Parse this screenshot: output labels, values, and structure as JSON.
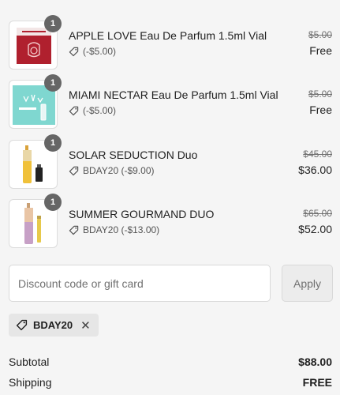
{
  "items": [
    {
      "quantity": "1",
      "name": "APPLE LOVE Eau De Parfum 1.5ml Vial",
      "discount": "(-$5.00)",
      "original_price": "$5.00",
      "final_price": "Free",
      "thumb_icon": "red-perfume-card-icon"
    },
    {
      "quantity": "1",
      "name": "MIAMI NECTAR Eau De Parfum 1.5ml Vial",
      "discount": "(-$5.00)",
      "original_price": "$5.00",
      "final_price": "Free",
      "thumb_icon": "teal-perfume-card-icon"
    },
    {
      "quantity": "1",
      "name": "SOLAR SEDUCTION Duo",
      "discount": "BDAY20 (-$9.00)",
      "original_price": "$45.00",
      "final_price": "$36.00",
      "thumb_icon": "perfume-duo-icon"
    },
    {
      "quantity": "1",
      "name": "SUMMER GOURMAND DUO",
      "discount": "BDAY20 (-$13.00)",
      "original_price": "$65.00",
      "final_price": "$52.00",
      "thumb_icon": "perfume-duo-icon"
    }
  ],
  "discount_form": {
    "placeholder": "Discount code or gift card",
    "apply_label": "Apply"
  },
  "applied_code": "BDAY20",
  "summary": {
    "subtotal_label": "Subtotal",
    "subtotal_value": "$88.00",
    "shipping_label": "Shipping",
    "shipping_value": "FREE"
  },
  "colors": {
    "badge": "#666666",
    "background": "#f5f5f5"
  }
}
